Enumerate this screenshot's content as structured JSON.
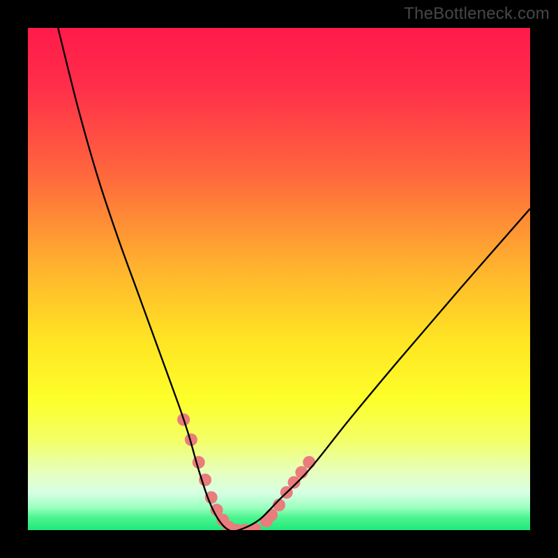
{
  "attribution": "TheBottleneck.com",
  "chart_data": {
    "type": "line",
    "title": "",
    "xlabel": "",
    "ylabel": "",
    "xlim": [
      0,
      100
    ],
    "ylim": [
      0,
      100
    ],
    "gradient_stops": [
      {
        "pos": 0.0,
        "color": "#ff1a4b"
      },
      {
        "pos": 0.12,
        "color": "#ff2f4a"
      },
      {
        "pos": 0.3,
        "color": "#ff6a3c"
      },
      {
        "pos": 0.48,
        "color": "#ffb42e"
      },
      {
        "pos": 0.62,
        "color": "#ffe423"
      },
      {
        "pos": 0.74,
        "color": "#fdff2a"
      },
      {
        "pos": 0.82,
        "color": "#f3ff65"
      },
      {
        "pos": 0.88,
        "color": "#e7ffb8"
      },
      {
        "pos": 0.925,
        "color": "#d8ffe4"
      },
      {
        "pos": 0.955,
        "color": "#9cffc1"
      },
      {
        "pos": 0.975,
        "color": "#4cf58f"
      },
      {
        "pos": 1.0,
        "color": "#20e87a"
      }
    ],
    "series": [
      {
        "name": "bottleneck-curve",
        "type": "line",
        "color": "#000000",
        "x": [
          6,
          10,
          14,
          18,
          22,
          26,
          30,
          32,
          34,
          36,
          38,
          40,
          42,
          46,
          50,
          56,
          64,
          74,
          86,
          100
        ],
        "y": [
          100,
          84,
          70,
          58,
          47,
          36,
          25,
          19,
          12,
          6,
          2,
          0,
          0,
          2,
          6,
          12,
          22,
          34,
          48,
          64
        ]
      },
      {
        "name": "highlight-markers",
        "type": "scatter",
        "color": "#e97c7c",
        "marker_radius_px": 9,
        "x": [
          31.0,
          32.5,
          34.0,
          35.3,
          36.5,
          37.6,
          38.8,
          40.0,
          41.5,
          43.2,
          45.2,
          47.5,
          48.5,
          50.0,
          51.5,
          53.0,
          54.5,
          56.0
        ],
        "y": [
          22.0,
          18.0,
          13.5,
          10.0,
          6.5,
          4.0,
          2.0,
          0.6,
          0.0,
          0.0,
          0.2,
          1.8,
          3.0,
          5.0,
          7.5,
          9.5,
          11.5,
          13.5
        ]
      }
    ]
  }
}
